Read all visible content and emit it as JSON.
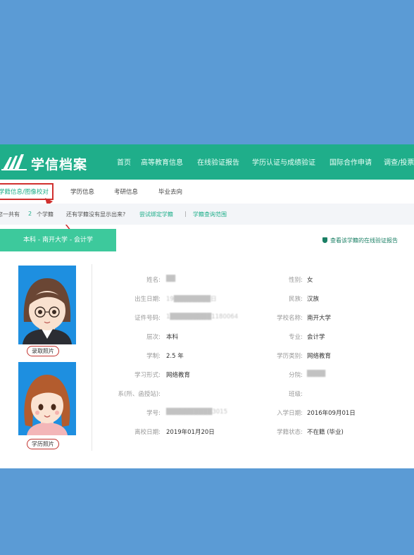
{
  "brand": {
    "title": "学信档案"
  },
  "nav": [
    "首页",
    "高等教育信息",
    "在线验证报告",
    "学历认证与成绩验证",
    "国际合作申请",
    "调查/投票"
  ],
  "subnav": {
    "tabs": [
      "学籍信息/图像校对",
      "学历信息",
      "考研信息",
      "毕业去向"
    ],
    "active": 0
  },
  "info": {
    "prefix": "您一共有",
    "count": "2",
    "suffix": "个学籍",
    "question": "还有学籍没有显示出来?",
    "link_bind": "尝试绑定学籍",
    "separator": "|",
    "link_scope": "学籍查询范围"
  },
  "record_button": "本科 - 南开大学 - 会计学",
  "verify_link": "查看该学籍的在线验证报告",
  "photos": {
    "admission": "录取照片",
    "degree": "学历照片"
  },
  "fields": {
    "name": {
      "label": "姓名:",
      "value": "██"
    },
    "gender": {
      "label": "性别:",
      "value": "女"
    },
    "birth": {
      "label": "出生日期:",
      "value": "19████████日"
    },
    "ethnicity": {
      "label": "民族:",
      "value": "汉族"
    },
    "id": {
      "label": "证件号码:",
      "value": "1█████████1180064"
    },
    "school": {
      "label": "学校名称:",
      "value": "南开大学"
    },
    "level": {
      "label": "层次:",
      "value": "本科"
    },
    "major": {
      "label": "专业:",
      "value": "会计学"
    },
    "years": {
      "label": "学制:",
      "value": "2.5 年"
    },
    "category": {
      "label": "学历类别:",
      "value": "网络教育"
    },
    "form": {
      "label": "学习形式:",
      "value": "网络教育"
    },
    "branch": {
      "label": "分院:",
      "value": "████"
    },
    "dept": {
      "label": "系(所、函授站):",
      "value": ""
    },
    "class": {
      "label": "班级:",
      "value": ""
    },
    "student_no": {
      "label": "学号:",
      "value": "██████████3015"
    },
    "enroll": {
      "label": "入学日期:",
      "value": "2016年09月01日"
    },
    "leave": {
      "label": "离校日期:",
      "value": "2019年01月20日"
    },
    "status": {
      "label": "学籍状态:",
      "value": "不在籍 (毕业)"
    }
  },
  "colors": {
    "header": "#1fae8a",
    "button": "#3dc99c",
    "background": "#5b9bd5",
    "photo_bg": "#1e8fe0",
    "highlight": "#d0302e"
  },
  "icons": [
    "logo-icon",
    "shield-icon",
    "arrow-annotation-icon"
  ]
}
